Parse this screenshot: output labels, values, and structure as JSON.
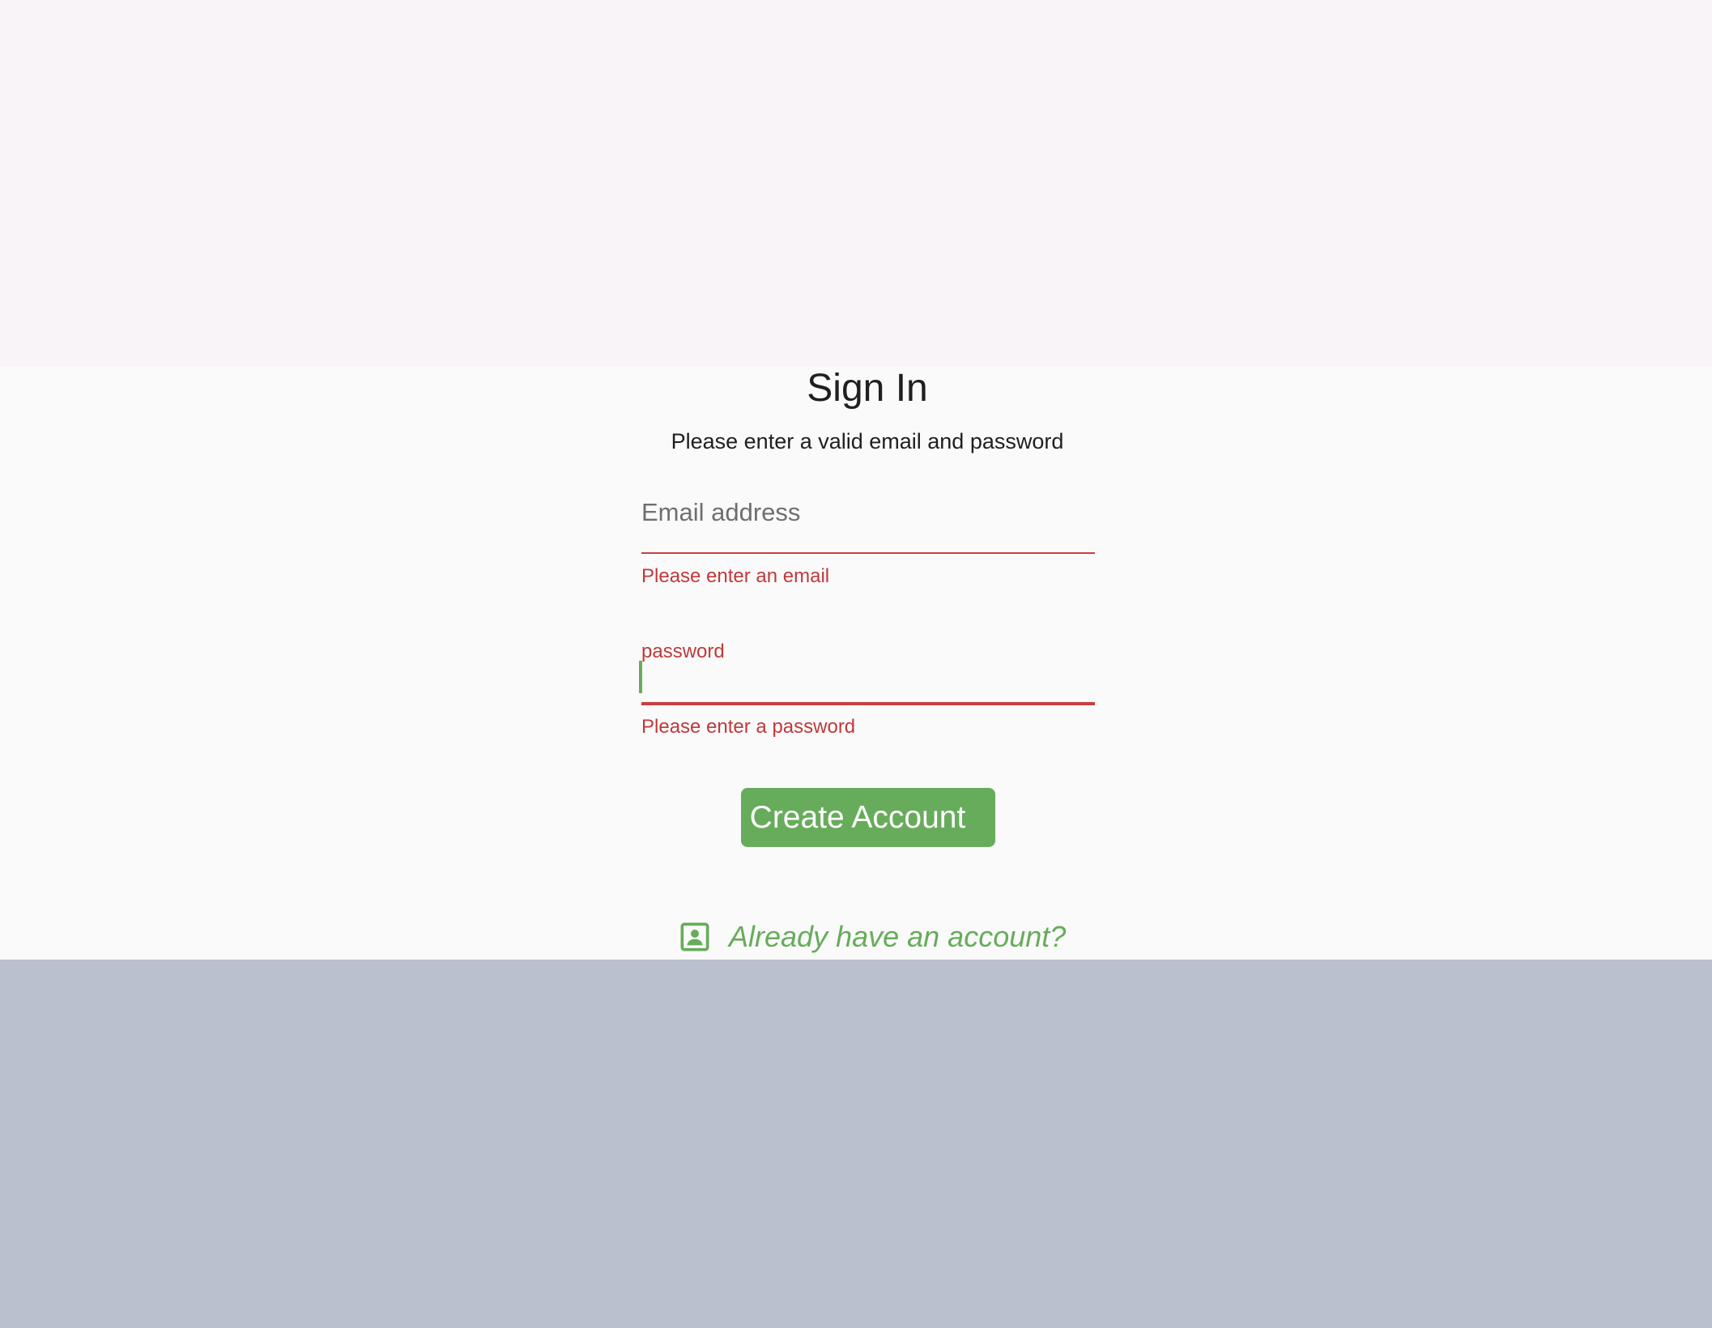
{
  "form": {
    "title": "Sign In",
    "subtitle": "Please enter a valid email and password",
    "email": {
      "placeholder": "Email address",
      "value": "",
      "error": "Please enter an email"
    },
    "password": {
      "label": "password",
      "value": "",
      "error": "Please enter a password"
    },
    "create_button_label": "Create Account",
    "already_link_label": "Already have an account?",
    "already_link_icon": "account-box-icon"
  },
  "colors": {
    "accent": "#67ac5b",
    "error": "#c8403f",
    "top_background": "#f9f4f7",
    "content_background": "#fafafa",
    "bottom_background": "#bbc0cf"
  }
}
